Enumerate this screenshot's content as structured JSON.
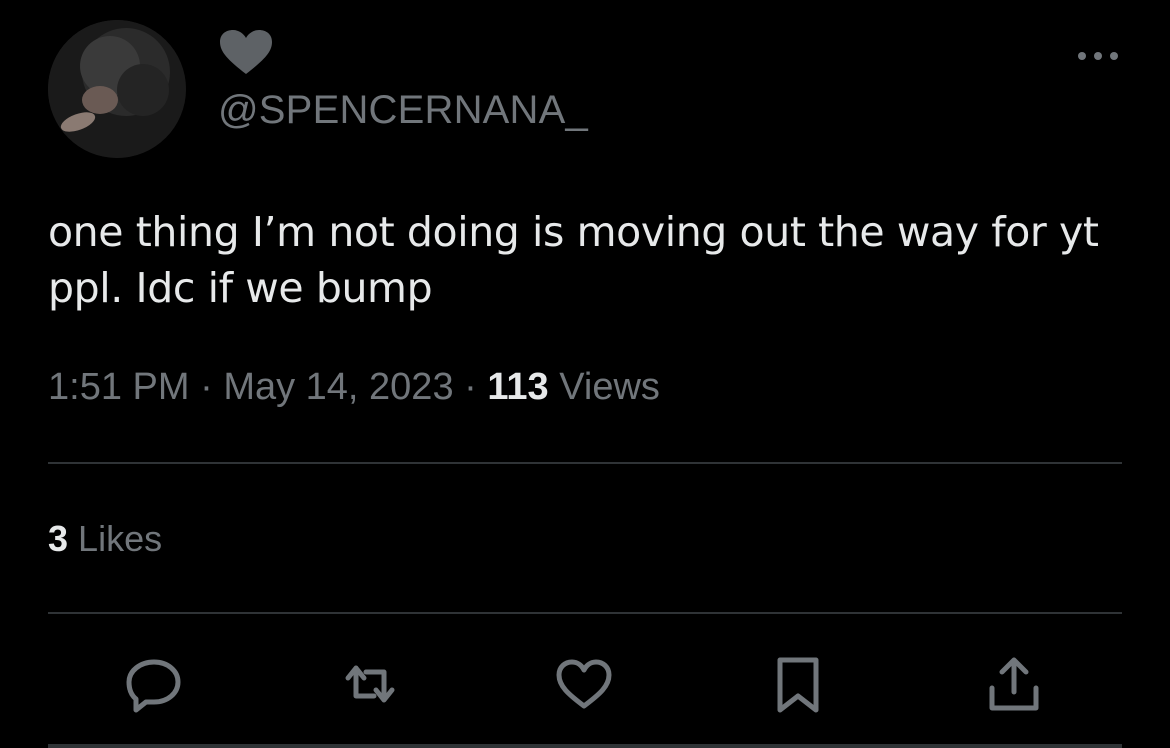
{
  "author": {
    "handle": "@SPENCERNANA_",
    "avatar_icon": "profile-photo",
    "name_icon": "heart-icon"
  },
  "tweet": {
    "text": "one thing I’m not doing is moving out the way for yt ppl. Idc if we bump",
    "time": "1:51 PM",
    "separator": "·",
    "date": "May 14, 2023",
    "views_count": "113",
    "views_label": "Views"
  },
  "engagement": {
    "likes_count": "3",
    "likes_label": "Likes"
  },
  "actions": [
    {
      "name": "reply",
      "icon": "reply-icon"
    },
    {
      "name": "retweet",
      "icon": "retweet-icon"
    },
    {
      "name": "like",
      "icon": "like-icon"
    },
    {
      "name": "bookmark",
      "icon": "bookmark-icon"
    },
    {
      "name": "share",
      "icon": "share-icon"
    }
  ],
  "colors": {
    "background": "#000000",
    "text_primary": "#e7e9ea",
    "text_secondary": "#71767b",
    "divider": "#2f3336"
  }
}
